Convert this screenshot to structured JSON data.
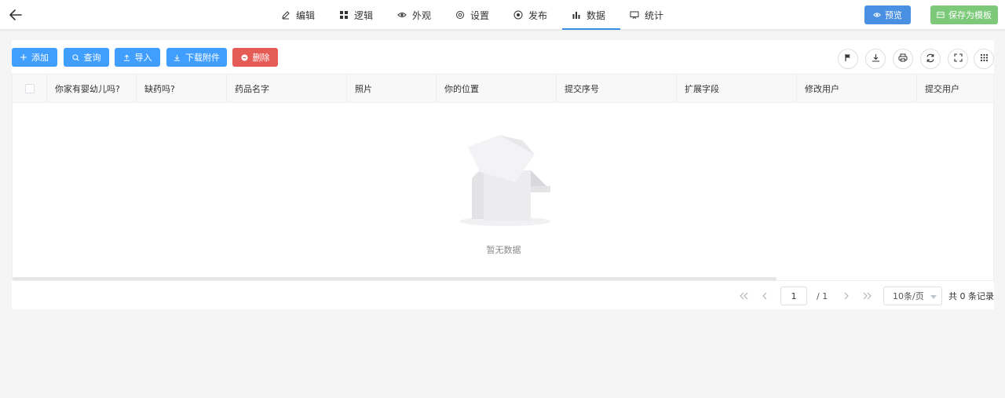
{
  "header": {
    "tabs": [
      {
        "label": "编辑",
        "icon": "pencil-icon"
      },
      {
        "label": "逻辑",
        "icon": "grid-icon"
      },
      {
        "label": "外观",
        "icon": "eye-icon"
      },
      {
        "label": "设置",
        "icon": "gear-icon"
      },
      {
        "label": "发布",
        "icon": "publish-icon"
      },
      {
        "label": "数据",
        "icon": "bar-chart-icon",
        "active": true
      },
      {
        "label": "统计",
        "icon": "stats-icon"
      }
    ],
    "preview_label": "预览",
    "save_template_label": "保存为模板",
    "accent_color": "#409eff",
    "save_color": "#7cc97a"
  },
  "toolbar": {
    "add_label": "添加",
    "query_label": "查询",
    "import_label": "导入",
    "download_label": "下载附件",
    "delete_label": "删除",
    "delete_color": "#e55b56"
  },
  "table": {
    "columns": [
      "你家有婴幼儿吗?",
      "缺药吗?",
      "药品名字",
      "照片",
      "你的位置",
      "提交序号",
      "扩展字段",
      "修改用户",
      "提交用户"
    ],
    "rows": [],
    "empty_text": "暂无数据"
  },
  "pagination": {
    "current_page": "1",
    "total_pages": "/ 1",
    "page_size": "10条/页",
    "total_records": "共 0 条记录"
  }
}
